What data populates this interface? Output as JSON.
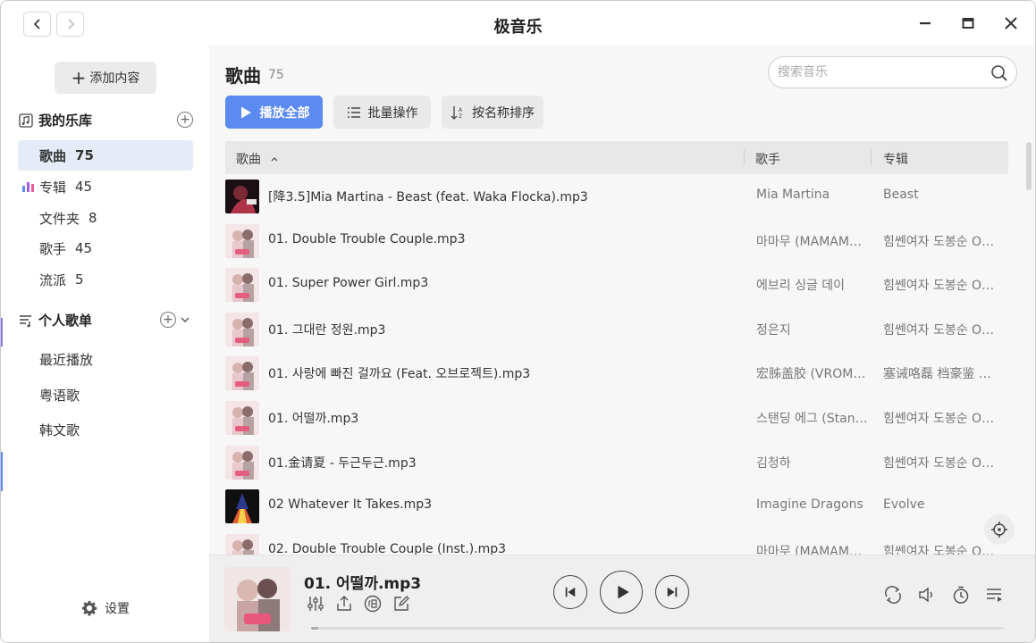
{
  "window": {
    "title": "极音乐"
  },
  "sidebar": {
    "add_content_label": "添加内容",
    "library_heading": "我的乐库",
    "library_items": [
      {
        "label": "歌曲",
        "count": "75",
        "active": true
      },
      {
        "label": "专辑",
        "count": "45",
        "active": false
      },
      {
        "label": "文件夹",
        "count": "8",
        "active": false
      },
      {
        "label": "歌手",
        "count": "45",
        "active": false
      },
      {
        "label": "流派",
        "count": "5",
        "active": false
      }
    ],
    "playlist_heading": "个人歌单",
    "playlists": [
      {
        "label": "最近播放"
      },
      {
        "label": "粤语歌"
      },
      {
        "label": "韩文歌"
      }
    ],
    "settings_label": "设置"
  },
  "main": {
    "title": "歌曲",
    "count": "75",
    "search": {
      "placeholder": "搜索音乐"
    },
    "toolbar": {
      "play_all": "播放全部",
      "batch": "批量操作",
      "sort": "按名称排序"
    },
    "columns": {
      "title": "歌曲",
      "artist": "歌手",
      "album": "专辑"
    },
    "rows": [
      {
        "title": "[降3.5]Mia Martina - Beast (feat. Waka Flocka).mp3",
        "artist": "Mia Martina",
        "album": "Beast",
        "cover": "dark-red"
      },
      {
        "title": "01. Double Trouble Couple.mp3",
        "artist": "마마무 (MAMAMOO)",
        "album": "힘쎈여자 도봉순 OST",
        "cover": "pink"
      },
      {
        "title": "01. Super Power Girl.mp3",
        "artist": "에브리 싱글 데이",
        "album": "힘쎈여자 도봉순 OST",
        "cover": "pink"
      },
      {
        "title": "01. 그대란 정원.mp3",
        "artist": "정은지",
        "album": "힘쎈여자 도봉순 OST",
        "cover": "pink"
      },
      {
        "title": "01. 사랑에 빠진 걸까요 (Feat. 오브로젝트).mp3",
        "artist": "宏胏盖胶 (VROMANCE)",
        "album": "塞诫咯磊 档豪鉴 OST",
        "cover": "pink"
      },
      {
        "title": "01. 어떨까.mp3",
        "artist": "스탠딩 에그 (Standing Egg)",
        "album": "힘쎈여자 도봉순 OST",
        "cover": "pink"
      },
      {
        "title": "01.金请夏 - 두근두근.mp3",
        "artist": "김청하",
        "album": "힘쎈여자 도봉순 OST",
        "cover": "pink"
      },
      {
        "title": "02 Whatever It Takes.mp3",
        "artist": "Imagine Dragons",
        "album": "Evolve",
        "cover": "black"
      },
      {
        "title": "02. Double Trouble Couple (Inst.).mp3",
        "artist": "마마무 (MAMAMOO)",
        "album": "힘쎈여자 도봉순 OST",
        "cover": "pink"
      }
    ]
  },
  "player": {
    "title": "01. 어떨까.mp3",
    "progress": 0.01
  }
}
